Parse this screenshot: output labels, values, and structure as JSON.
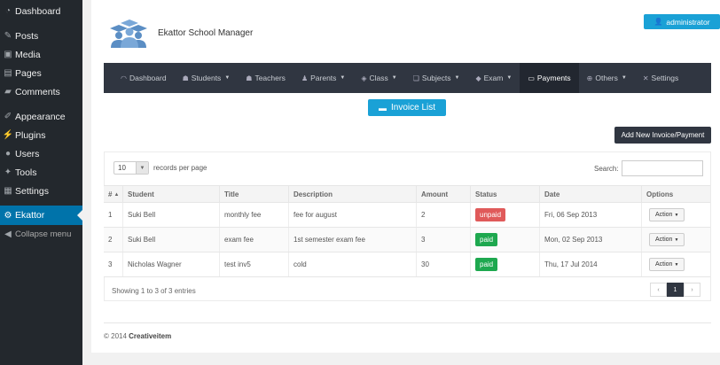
{
  "sidebar": {
    "items": [
      {
        "label": "Dashboard",
        "icon": "dashboard-icon"
      },
      {
        "label": "Posts",
        "icon": "pin-icon"
      },
      {
        "label": "Media",
        "icon": "media-icon"
      },
      {
        "label": "Pages",
        "icon": "page-icon"
      },
      {
        "label": "Comments",
        "icon": "comment-icon"
      },
      {
        "label": "Appearance",
        "icon": "brush-icon"
      },
      {
        "label": "Plugins",
        "icon": "plug-icon"
      },
      {
        "label": "Users",
        "icon": "user-icon"
      },
      {
        "label": "Tools",
        "icon": "wrench-icon"
      },
      {
        "label": "Settings",
        "icon": "settings-icon"
      },
      {
        "label": "Ekattor",
        "icon": "gear-icon"
      },
      {
        "label": "Collapse menu",
        "icon": "collapse-icon"
      }
    ]
  },
  "header": {
    "school_name": "Ekattor School Manager",
    "user_label": "administrator"
  },
  "nav": {
    "items": [
      {
        "label": "Dashboard",
        "icon": "gauge-icon",
        "dropdown": false
      },
      {
        "label": "Students",
        "icon": "students-icon",
        "dropdown": true
      },
      {
        "label": "Teachers",
        "icon": "teachers-icon",
        "dropdown": false
      },
      {
        "label": "Parents",
        "icon": "parent-icon",
        "dropdown": true
      },
      {
        "label": "Class",
        "icon": "class-icon",
        "dropdown": true
      },
      {
        "label": "Subjects",
        "icon": "subjects-icon",
        "dropdown": true
      },
      {
        "label": "Exam",
        "icon": "exam-icon",
        "dropdown": true
      },
      {
        "label": "Payments",
        "icon": "payments-icon",
        "dropdown": false
      },
      {
        "label": "Others",
        "icon": "others-icon",
        "dropdown": true
      },
      {
        "label": "Settings",
        "icon": "tools-icon",
        "dropdown": false
      }
    ],
    "active": "Payments"
  },
  "buttons": {
    "invoice_list": "Invoice List",
    "add_new": "Add New Invoice/Payment"
  },
  "table_controls": {
    "page_length": "10",
    "page_length_label": "records per page",
    "search_label": "Search:",
    "search_value": ""
  },
  "table": {
    "columns": [
      "#",
      "Student",
      "Title",
      "Description",
      "Amount",
      "Status",
      "Date",
      "Options"
    ],
    "rows": [
      {
        "num": "1",
        "student": "Suki Bell",
        "title": "monthly fee",
        "description": "fee for august",
        "amount": "2",
        "status": "unpaid",
        "date": "Fri, 06 Sep 2013",
        "option": "Action"
      },
      {
        "num": "2",
        "student": "Suki Bell",
        "title": "exam fee",
        "description": "1st semester exam fee",
        "amount": "3",
        "status": "paid",
        "date": "Mon, 02 Sep 2013",
        "option": "Action"
      },
      {
        "num": "3",
        "student": "Nicholas Wagner",
        "title": "test inv5",
        "description": "cold",
        "amount": "30",
        "status": "paid",
        "date": "Thu, 17 Jul 2014",
        "option": "Action"
      }
    ]
  },
  "pagination": {
    "info": "Showing 1 to 3 of 3 entries",
    "prev": "‹",
    "current": "1",
    "next": "›"
  },
  "footer": {
    "copyright": "© 2014",
    "brand": "Creativeitem"
  },
  "colors": {
    "accent": "#1aa1d6",
    "nav_bg": "#303641",
    "wp_sidebar": "#23282d",
    "wp_active": "#0073aa",
    "unpaid": "#e05a5a",
    "paid": "#1ea84f"
  }
}
